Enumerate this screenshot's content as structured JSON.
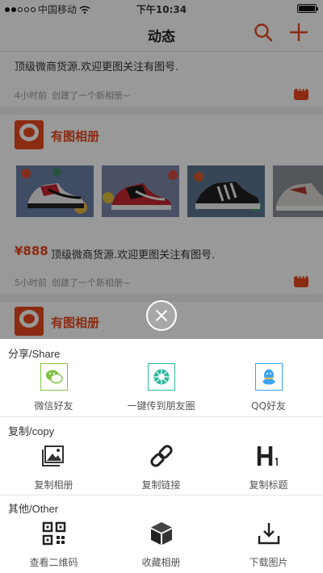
{
  "status_bar": {
    "carrier": "中国移动",
    "time": "下午10:34"
  },
  "nav": {
    "title": "动态",
    "search_icon": "search-icon",
    "add_icon": "plus-icon",
    "accent": "#e8491d"
  },
  "feed": {
    "post1": {
      "text": "顶级微商货源.欢迎更图关注有图号.",
      "time": "4小时前",
      "action": "创建了一个新相册~"
    },
    "post2": {
      "album_name": "有图相册",
      "price": "¥888",
      "text": "顶级微商货源.欢迎更图关注有图号.",
      "time": "5小时前",
      "action": "创建了一个新相册~"
    },
    "post3": {
      "album_name": "有图相册"
    }
  },
  "sheet": {
    "share": {
      "title": "分享/Share",
      "items": [
        {
          "label": "微信好友",
          "icon": "wechat-icon",
          "color": "#7fc241"
        },
        {
          "label": "一键传到朋友圈",
          "icon": "moments-icon",
          "color": "#2bbb9e"
        },
        {
          "label": "QQ好友",
          "icon": "qq-icon",
          "color": "#3aa3f0"
        }
      ]
    },
    "copy": {
      "title": "复制/copy",
      "items": [
        {
          "label": "复制相册",
          "icon": "image-icon"
        },
        {
          "label": "复制链接",
          "icon": "link-icon"
        },
        {
          "label": "复制标题",
          "icon": "heading-icon"
        }
      ]
    },
    "other": {
      "title": "其他/Other",
      "items": [
        {
          "label": "查看二维码",
          "icon": "qrcode-icon"
        },
        {
          "label": "收藏相册",
          "icon": "box-icon"
        },
        {
          "label": "下载图片",
          "icon": "download-icon"
        }
      ]
    }
  }
}
